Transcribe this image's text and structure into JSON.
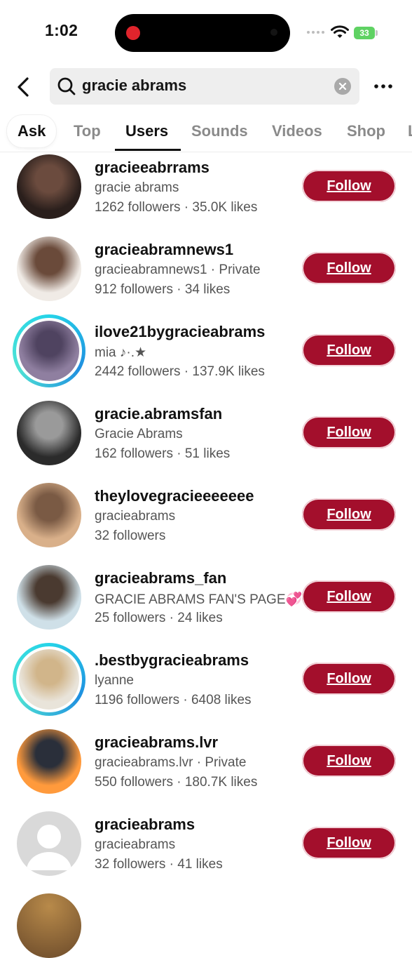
{
  "status": {
    "time": "1:02",
    "battery": "33"
  },
  "search": {
    "query": "gracie abrams"
  },
  "tabs": [
    "Ask",
    "Top",
    "Users",
    "Sounds",
    "Videos",
    "Shop",
    "L"
  ],
  "active_tab": "Users",
  "users": [
    {
      "username": "gracieeabrrams",
      "display": "gracie abrams",
      "stats": "1262 followers · 35.0K likes",
      "follow": "Follow",
      "colors": [
        "#2a1f1c",
        "#6b4b3e"
      ]
    },
    {
      "username": "gracieabramnews1",
      "display": "gracieabramnews1 · Private",
      "stats": "912 followers · 34 likes",
      "follow": "Follow",
      "colors": [
        "#f0ebe6",
        "#6a4a3a"
      ]
    },
    {
      "username": "ilove21bygracieabrams",
      "display": "mia ♪·.★",
      "stats": "2442 followers · 137.9K likes",
      "follow": "Follow",
      "colors": [
        "#8f7fa0",
        "#4f4360"
      ]
    },
    {
      "username": "gracie.abramsfan",
      "display": "Gracie Abrams",
      "stats": "162 followers · 51 likes",
      "follow": "Follow",
      "colors": [
        "#2b2b2b",
        "#9a9a9a"
      ]
    },
    {
      "username": "theylovegracieeeeeee",
      "display": "gracieabrams",
      "stats": "32 followers",
      "follow": "Follow",
      "colors": [
        "#d9b08a",
        "#7a5a44"
      ]
    },
    {
      "username": "gracieabrams_fan",
      "display": "GRACIE ABRAMS FAN'S PAGE💞",
      "stats": "25 followers · 24 likes",
      "follow": "Follow",
      "colors": [
        "#cfe0e8",
        "#4a3a30"
      ]
    },
    {
      "username": ".bestbygracieabrams",
      "display": "lyanne",
      "stats": "1196 followers · 6408 likes",
      "follow": "Follow",
      "colors": [
        "#e9e4da",
        "#d1b58a"
      ]
    },
    {
      "username": "gracieabrams.lvr",
      "display": "gracieabrams.lvr · Private",
      "stats": "550 followers · 180.7K likes",
      "follow": "Follow",
      "colors": [
        "#ff9a3c",
        "#2a2f3a"
      ]
    },
    {
      "username": "gracieabrams",
      "display": "gracieabrams",
      "stats": "32 followers · 41 likes",
      "follow": "Follow",
      "colors": [
        "#d9d9d9",
        "#ffffff"
      ]
    }
  ]
}
